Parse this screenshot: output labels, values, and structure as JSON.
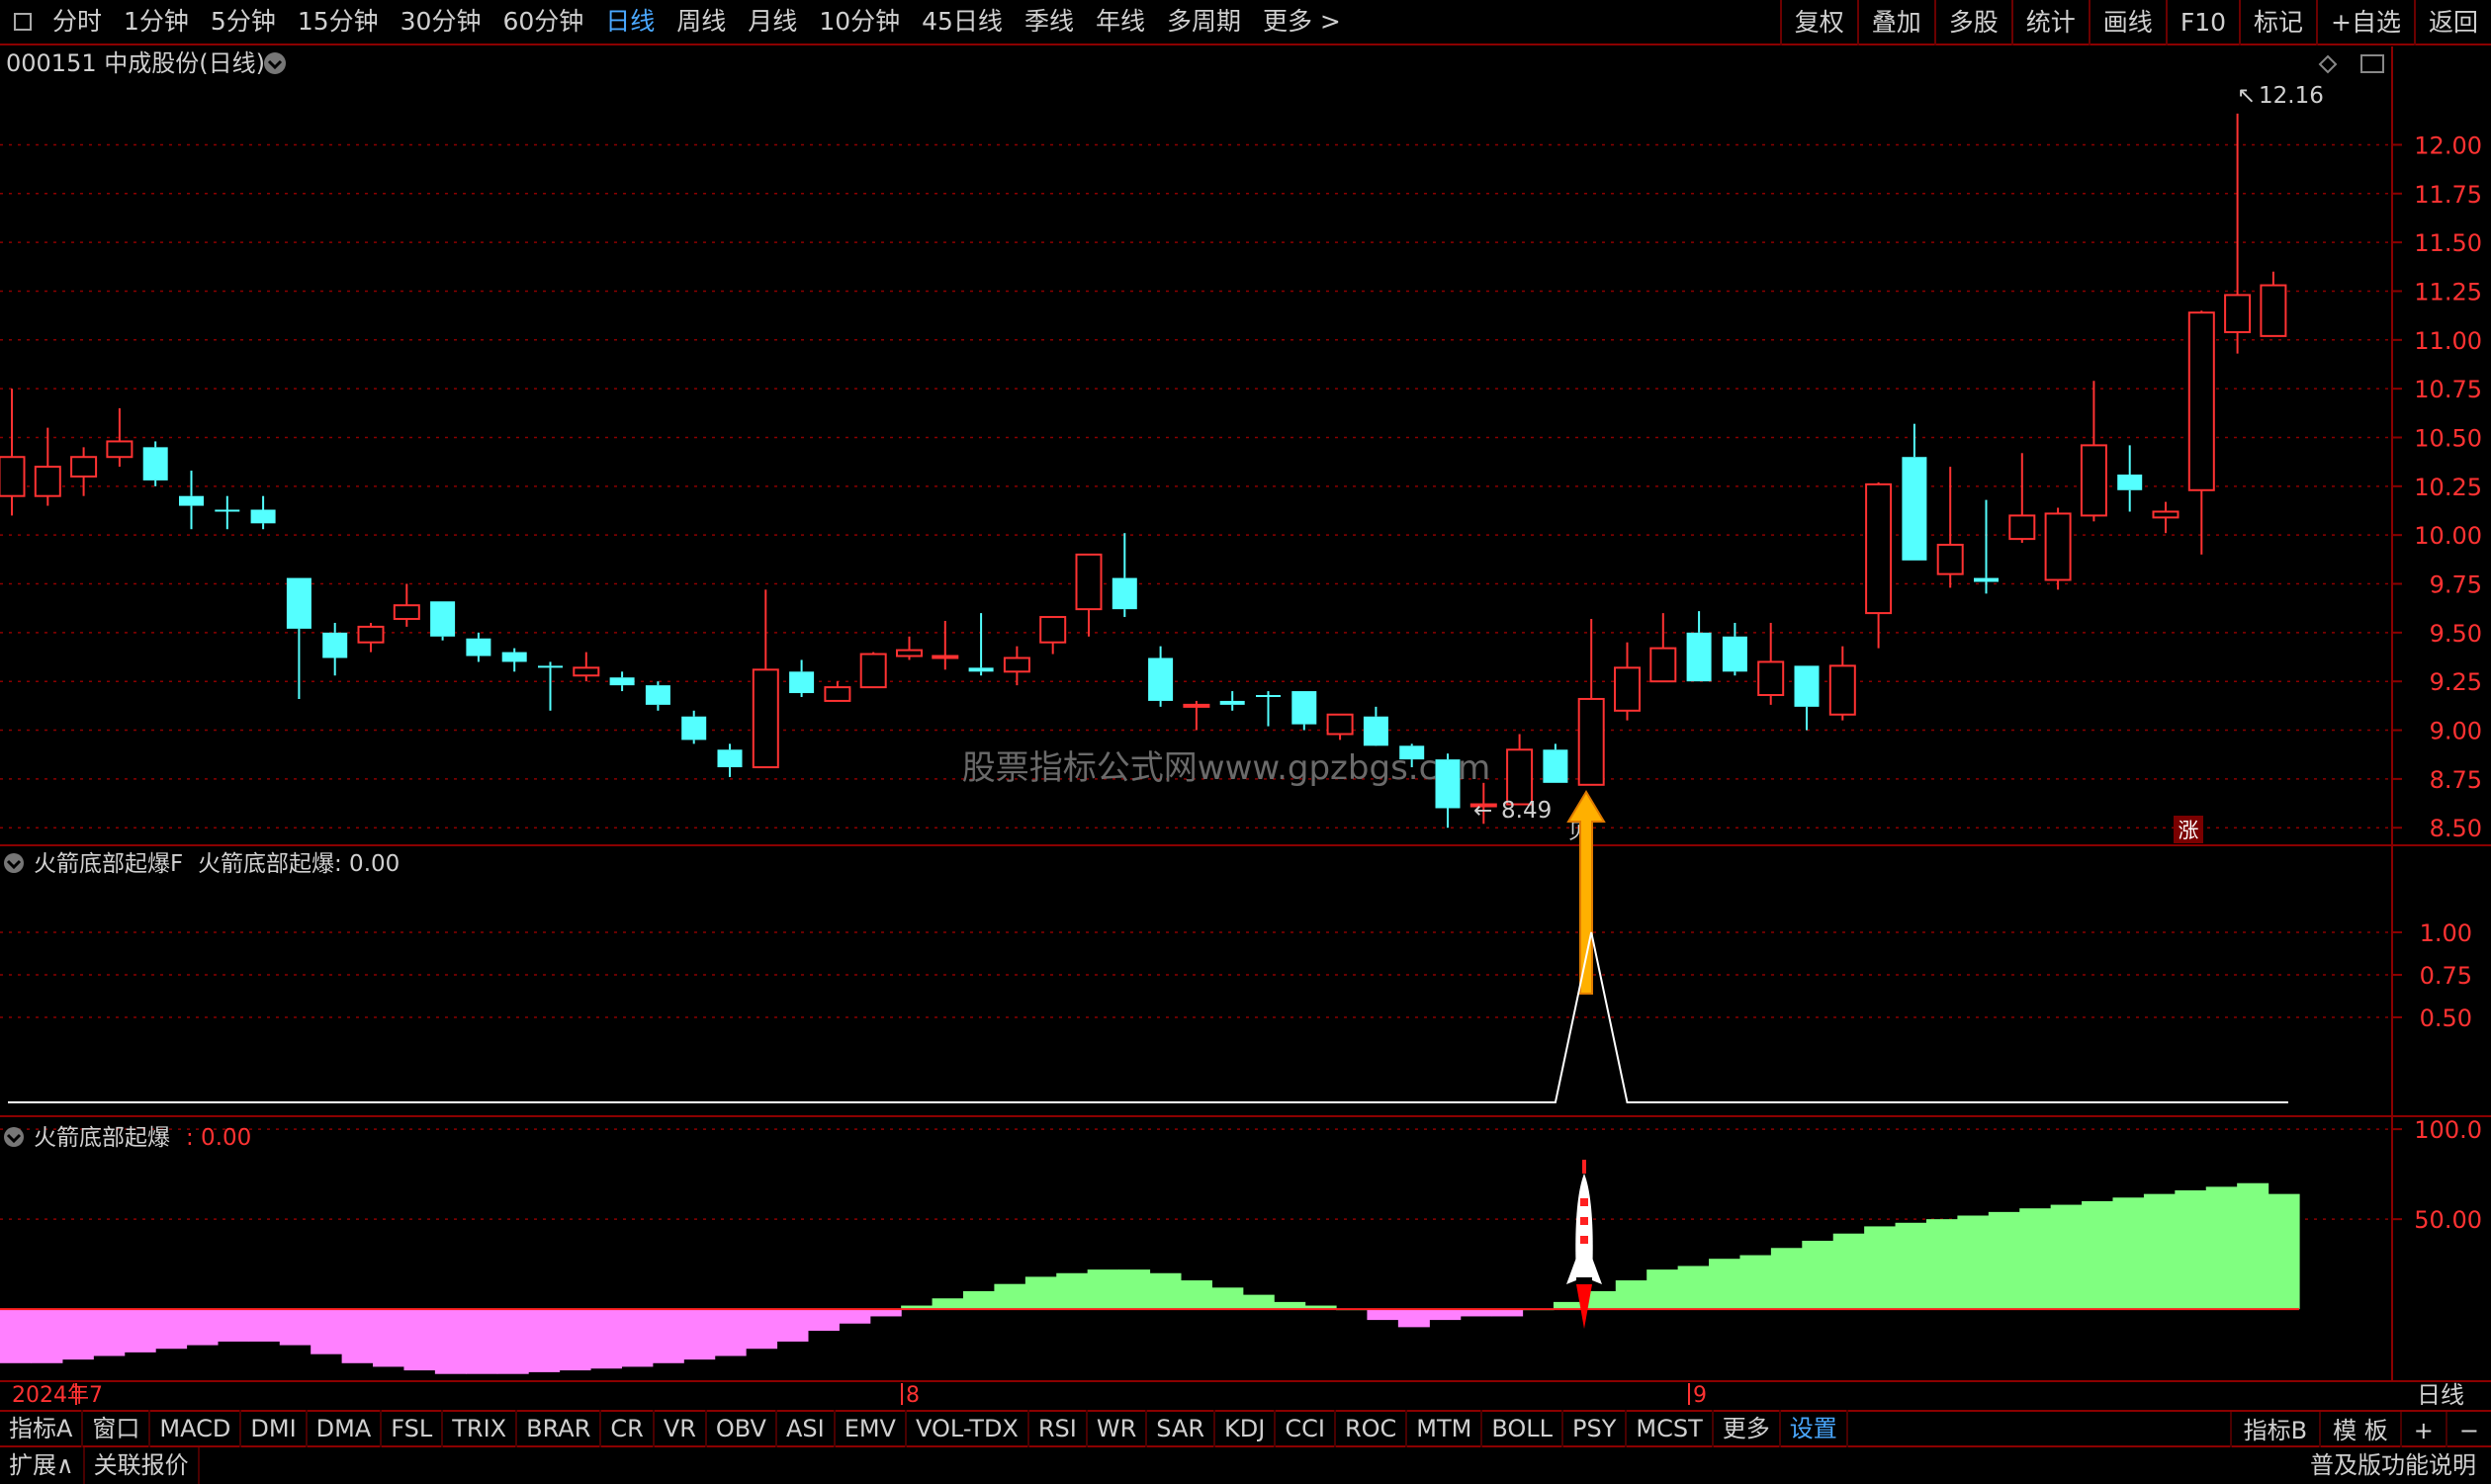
{
  "toolbar": {
    "periods": [
      "分时",
      "1分钟",
      "5分钟",
      "15分钟",
      "30分钟",
      "60分钟",
      "日线",
      "周线",
      "月线",
      "10分钟",
      "45日线",
      "季线",
      "年线",
      "多周期",
      "更多 >"
    ],
    "active_period": "日线",
    "right_buttons": [
      "复权",
      "叠加",
      "多股",
      "统计",
      "画线",
      "F10",
      "标记",
      "+自选",
      "返回"
    ]
  },
  "main_panel": {
    "title": "000151 中成股份(日线)",
    "high_label": "12.16",
    "low_label": "8.49",
    "buy_marker": "贝",
    "rise_marker": "涨",
    "watermark": "股票指标公式网www.gpzbgs.com",
    "y_ticks": [
      "12.00",
      "11.75",
      "11.50",
      "11.25",
      "11.00",
      "10.75",
      "10.50",
      "10.25",
      "10.00",
      "9.75",
      "9.50",
      "9.25",
      "9.00",
      "8.75",
      "8.50"
    ]
  },
  "panel2": {
    "label": "火箭底部起爆F",
    "value_label": "火箭底部起爆: 0.00",
    "y_ticks": [
      "1.00",
      "0.75",
      "0.50"
    ]
  },
  "panel3": {
    "label": "火箭底部起爆",
    "value_text": ": 0.00",
    "y_ticks": [
      "100.0",
      "50.00"
    ]
  },
  "x_axis": {
    "labels": [
      "2024年7",
      "8",
      "9"
    ],
    "period_label": "日线"
  },
  "bottom_tabs": [
    "指标A",
    "窗口",
    "MACD",
    "DMI",
    "DMA",
    "FSL",
    "TRIX",
    "BRAR",
    "CR",
    "VR",
    "OBV",
    "ASI",
    "EMV",
    "VOL-TDX",
    "RSI",
    "WR",
    "SAR",
    "KDJ",
    "CCI",
    "ROC",
    "MTM",
    "BOLL",
    "PSY",
    "MCST",
    "更多",
    "设置"
  ],
  "bottom_tabs_active": "设置",
  "bottom_right_tabs": [
    "指标B",
    "模 板",
    "+",
    "−"
  ],
  "status": {
    "expand": "扩展∧",
    "link": "关联报价",
    "right": "普及版功能说明"
  },
  "colors": {
    "up": "#ff3232",
    "down": "#54ffff",
    "grid": "#8b0000",
    "accent": "#4aa8ff",
    "pos_area": "#80ff80",
    "neg_area": "#ff80ff"
  },
  "chart_data": [
    {
      "type": "candlestick",
      "title": "000151 中成股份(日线)",
      "ylim": [
        8.4,
        12.2
      ],
      "candles": [
        {
          "o": 10.2,
          "h": 10.75,
          "l": 10.1,
          "c": 10.4
        },
        {
          "o": 10.2,
          "h": 10.55,
          "l": 10.15,
          "c": 10.35
        },
        {
          "o": 10.3,
          "h": 10.45,
          "l": 10.2,
          "c": 10.4
        },
        {
          "o": 10.4,
          "h": 10.65,
          "l": 10.35,
          "c": 10.48
        },
        {
          "o": 10.45,
          "h": 10.48,
          "l": 10.25,
          "c": 10.28
        },
        {
          "o": 10.2,
          "h": 10.33,
          "l": 10.03,
          "c": 10.15
        },
        {
          "o": 10.13,
          "h": 10.2,
          "l": 10.03,
          "c": 10.12
        },
        {
          "o": 10.13,
          "h": 10.2,
          "l": 10.03,
          "c": 10.06
        },
        {
          "o": 9.78,
          "h": 9.78,
          "l": 9.16,
          "c": 9.52
        },
        {
          "o": 9.5,
          "h": 9.55,
          "l": 9.28,
          "c": 9.37
        },
        {
          "o": 9.45,
          "h": 9.55,
          "l": 9.4,
          "c": 9.53
        },
        {
          "o": 9.57,
          "h": 9.75,
          "l": 9.53,
          "c": 9.64
        },
        {
          "o": 9.66,
          "h": 9.66,
          "l": 9.46,
          "c": 9.48
        },
        {
          "o": 9.47,
          "h": 9.5,
          "l": 9.35,
          "c": 9.38
        },
        {
          "o": 9.4,
          "h": 9.42,
          "l": 9.3,
          "c": 9.35
        },
        {
          "o": 9.33,
          "h": 9.35,
          "l": 9.1,
          "c": 9.32
        },
        {
          "o": 9.28,
          "h": 9.4,
          "l": 9.25,
          "c": 9.32
        },
        {
          "o": 9.27,
          "h": 9.3,
          "l": 9.2,
          "c": 9.23
        },
        {
          "o": 9.23,
          "h": 9.25,
          "l": 9.1,
          "c": 9.13
        },
        {
          "o": 9.07,
          "h": 9.1,
          "l": 8.93,
          "c": 8.95
        },
        {
          "o": 8.9,
          "h": 8.93,
          "l": 8.76,
          "c": 8.81
        },
        {
          "o": 8.81,
          "h": 9.72,
          "l": 8.81,
          "c": 9.31
        },
        {
          "o": 9.3,
          "h": 9.36,
          "l": 9.17,
          "c": 9.19
        },
        {
          "o": 9.15,
          "h": 9.25,
          "l": 9.15,
          "c": 9.22
        },
        {
          "o": 9.22,
          "h": 9.4,
          "l": 9.22,
          "c": 9.39
        },
        {
          "o": 9.38,
          "h": 9.48,
          "l": 9.36,
          "c": 9.41
        },
        {
          "o": 9.38,
          "h": 9.56,
          "l": 9.31,
          "c": 9.38
        },
        {
          "o": 9.32,
          "h": 9.6,
          "l": 9.28,
          "c": 9.3
        },
        {
          "o": 9.3,
          "h": 9.43,
          "l": 9.23,
          "c": 9.37
        },
        {
          "o": 9.45,
          "h": 9.55,
          "l": 9.39,
          "c": 9.58
        },
        {
          "o": 9.62,
          "h": 9.89,
          "l": 9.48,
          "c": 9.9
        },
        {
          "o": 9.78,
          "h": 10.01,
          "l": 9.58,
          "c": 9.62
        },
        {
          "o": 9.37,
          "h": 9.43,
          "l": 9.12,
          "c": 9.15
        },
        {
          "o": 9.12,
          "h": 9.15,
          "l": 9.0,
          "c": 9.13
        },
        {
          "o": 9.15,
          "h": 9.2,
          "l": 9.1,
          "c": 9.13
        },
        {
          "o": 9.18,
          "h": 9.2,
          "l": 9.02,
          "c": 9.17
        },
        {
          "o": 9.2,
          "h": 9.2,
          "l": 9.0,
          "c": 9.03
        },
        {
          "o": 8.98,
          "h": 9.08,
          "l": 8.95,
          "c": 9.08
        },
        {
          "o": 9.07,
          "h": 9.12,
          "l": 8.93,
          "c": 8.92
        },
        {
          "o": 8.92,
          "h": 8.93,
          "l": 8.81,
          "c": 8.85
        },
        {
          "o": 8.85,
          "h": 8.88,
          "l": 8.5,
          "c": 8.6
        },
        {
          "o": 8.62,
          "h": 8.73,
          "l": 8.52,
          "c": 8.62
        },
        {
          "o": 8.62,
          "h": 8.98,
          "l": 8.62,
          "c": 8.9
        },
        {
          "o": 8.9,
          "h": 8.93,
          "l": 8.73,
          "c": 8.73
        },
        {
          "o": 8.72,
          "h": 9.57,
          "l": 8.72,
          "c": 9.16
        },
        {
          "o": 9.1,
          "h": 9.45,
          "l": 9.05,
          "c": 9.32
        },
        {
          "o": 9.25,
          "h": 9.6,
          "l": 9.25,
          "c": 9.42
        },
        {
          "o": 9.5,
          "h": 9.61,
          "l": 9.25,
          "c": 9.25
        },
        {
          "o": 9.48,
          "h": 9.55,
          "l": 9.28,
          "c": 9.3
        },
        {
          "o": 9.18,
          "h": 9.55,
          "l": 9.13,
          "c": 9.35
        },
        {
          "o": 9.33,
          "h": 9.33,
          "l": 9.0,
          "c": 9.12
        },
        {
          "o": 9.08,
          "h": 9.43,
          "l": 9.05,
          "c": 9.33
        },
        {
          "o": 9.6,
          "h": 10.27,
          "l": 9.42,
          "c": 10.26
        },
        {
          "o": 10.4,
          "h": 10.57,
          "l": 9.87,
          "c": 9.87
        },
        {
          "o": 9.8,
          "h": 10.35,
          "l": 9.73,
          "c": 9.95
        },
        {
          "o": 9.78,
          "h": 10.18,
          "l": 9.7,
          "c": 9.76
        },
        {
          "o": 9.98,
          "h": 10.42,
          "l": 9.96,
          "c": 10.1
        },
        {
          "o": 9.77,
          "h": 10.14,
          "l": 9.72,
          "c": 10.11
        },
        {
          "o": 10.1,
          "h": 10.79,
          "l": 10.07,
          "c": 10.46
        },
        {
          "o": 10.31,
          "h": 10.46,
          "l": 10.12,
          "c": 10.23
        },
        {
          "o": 10.09,
          "h": 10.17,
          "l": 10.01,
          "c": 10.12
        },
        {
          "o": 10.23,
          "h": 11.15,
          "l": 9.9,
          "c": 11.14
        },
        {
          "o": 11.04,
          "h": 12.16,
          "l": 10.93,
          "c": 11.23
        },
        {
          "o": 11.02,
          "h": 11.35,
          "l": 11.02,
          "c": 11.28
        }
      ],
      "y_ticks": [
        12.0,
        11.75,
        11.5,
        11.25,
        11.0,
        10.75,
        10.5,
        10.25,
        10.0,
        9.75,
        9.5,
        9.25,
        9.0,
        8.75,
        8.5
      ],
      "annotations": [
        "12.16",
        "8.49",
        "贝",
        "涨"
      ]
    },
    {
      "type": "line",
      "title": "火箭底部起爆F",
      "ylim": [
        0,
        1.1
      ],
      "y_ticks": [
        1.0,
        0.75,
        0.5
      ],
      "signal_index": 44,
      "values_note_signal_peak": 1.0
    },
    {
      "type": "area",
      "title": "火箭底部起爆",
      "ylim": [
        -40,
        105
      ],
      "y_ticks": [
        100.0,
        50.0
      ],
      "values": [
        -30,
        -30,
        -28,
        -26,
        -24,
        -22,
        -20,
        -18,
        -18,
        -20,
        -25,
        -30,
        -32,
        -34,
        -36,
        -36,
        -36,
        -35,
        -34,
        -33,
        -32,
        -30,
        -28,
        -26,
        -22,
        -18,
        -12,
        -8,
        -4,
        2,
        6,
        10,
        14,
        18,
        20,
        22,
        22,
        20,
        16,
        12,
        8,
        4,
        2,
        0,
        -6,
        -10,
        -6,
        -4,
        -4,
        0,
        4,
        10,
        16,
        22,
        24,
        28,
        30,
        34,
        38,
        42,
        46,
        48,
        50,
        52,
        54,
        56,
        58,
        60,
        62,
        64,
        66,
        68,
        70,
        64
      ]
    }
  ]
}
